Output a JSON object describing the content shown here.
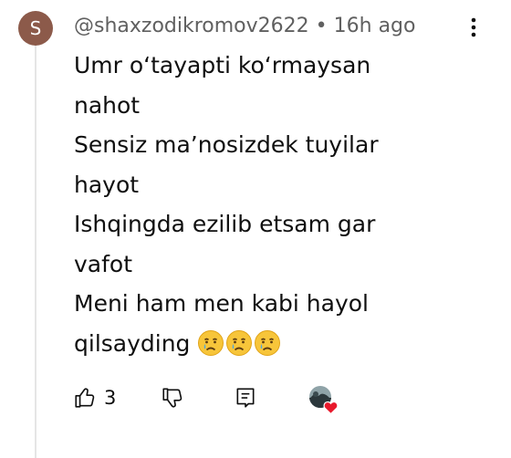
{
  "comment": {
    "avatar_letter": "S",
    "username": "@shaxzodikromov2622",
    "separator": "•",
    "timestamp": "16h ago",
    "lines": [
      "Umr o‘tayapti ko‘rmaysan",
      "nahot",
      "Sensiz ma’nosizdek tuyilar",
      "hayot",
      "Ishqingda ezilib etsam gar",
      "vafot",
      "Meni ham men kabi hayol",
      "qilsayding"
    ],
    "emojis": [
      "crying-face",
      "crying-face",
      "crying-face"
    ],
    "like_count": "3"
  },
  "icons": {
    "more": "vertical-dots-icon",
    "like": "thumbs-up-icon",
    "dislike": "thumbs-down-icon",
    "reply": "reply-comment-icon",
    "creator_heart": "creator-heart-icon"
  },
  "colors": {
    "avatar_bg": "#8c5a4a",
    "meta_text": "#606060",
    "text": "#0f0f0f",
    "heart": "#e8192c",
    "thread_line": "#e5e5e5"
  }
}
